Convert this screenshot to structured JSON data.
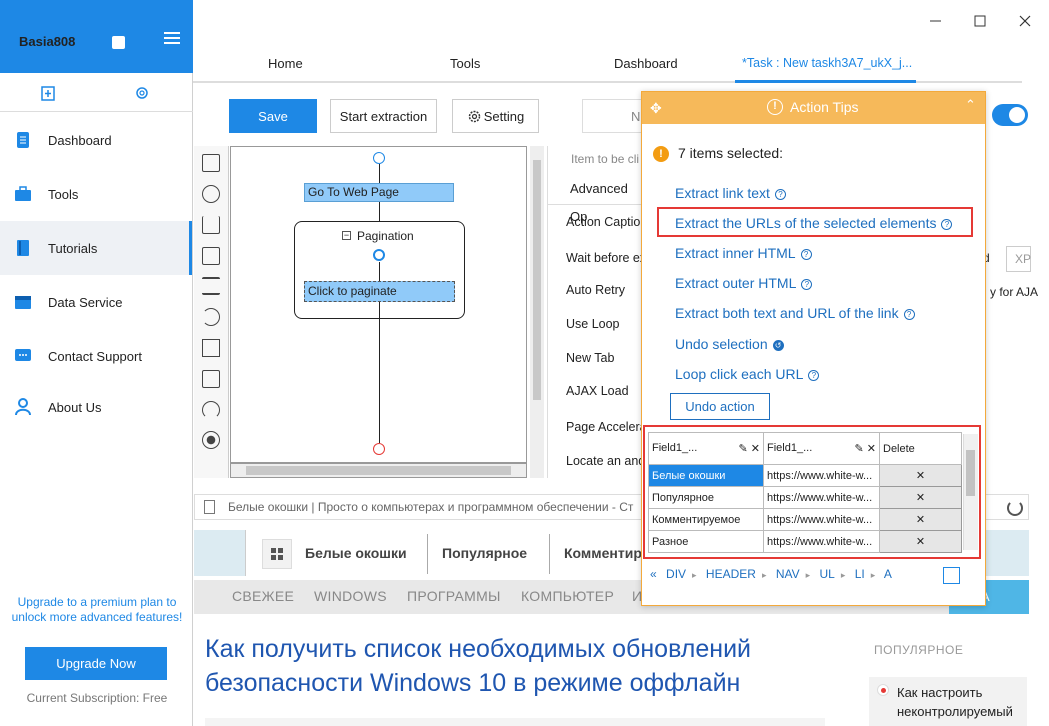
{
  "sidebar": {
    "username": "Basia808",
    "items": [
      {
        "label": "Dashboard",
        "icon": "dashboard-icon"
      },
      {
        "label": "Tools",
        "icon": "tools-icon"
      },
      {
        "label": "Tutorials",
        "icon": "book-icon"
      },
      {
        "label": "Data Service",
        "icon": "data-service-icon"
      },
      {
        "label": "Contact Support",
        "icon": "chat-icon"
      },
      {
        "label": "About Us",
        "icon": "person-icon"
      }
    ],
    "active_item": "Tutorials",
    "upgrade_text": "Upgrade to a premium plan to unlock more advanced features!",
    "upgrade_button": "Upgrade Now",
    "subscription": "Current Subscription: Free"
  },
  "tabs": [
    {
      "label": "Home"
    },
    {
      "label": "Tools"
    },
    {
      "label": "Dashboard"
    },
    {
      "label": "*Task : New taskh3A7_ukX_j..."
    }
  ],
  "toolbar": {
    "save": "Save",
    "start": "Start extraction",
    "setting": "Setting",
    "next_partial": "N"
  },
  "workflow": {
    "go_to_web_page": "Go To Web Page",
    "pagination": "Pagination",
    "click_to_paginate": "Click to paginate"
  },
  "options": {
    "hint": "Item to be cli",
    "tab": "Advanced Op",
    "rows": [
      "Action Caption",
      "Wait before ex",
      "Auto Retry",
      "Use Loop",
      "New Tab",
      "AJAX Load",
      "Page Accelera",
      "Locate an and"
    ],
    "d_label": "d",
    "xp_box": "XP",
    "ajax_label": "y for AJA"
  },
  "browser": {
    "address": "Белые окошки | Просто о компьютерах и программном обеспечении - Ст",
    "nav": [
      "Белые окошки",
      "Популярное",
      "Комментир"
    ],
    "menu": [
      "СВЕЖЕЕ",
      "WINDOWS",
      "ПРОГРАММЫ",
      "КОМПЬЮТЕР",
      "И"
    ],
    "menu_last": "А",
    "headline": "Как получить список необходимых обновлений безопасности Windows 10 в режиме оффлайн",
    "side_title": "ПОПУЛЯРНОЕ",
    "side_item": "Как настроить неконтролируемый"
  },
  "tips": {
    "title": "Action Tips",
    "selected": "7 items selected:",
    "actions": [
      "Extract link text",
      "Extract the URLs of the selected elements",
      "Extract inner HTML",
      "Extract outer HTML",
      "Extract both text and URL of the link",
      "Undo selection",
      "Loop click each URL"
    ],
    "undo_action": "Undo action",
    "table": {
      "headers": [
        "Field1_...",
        "Field1_...",
        "Delete"
      ],
      "rows": [
        [
          "Белые окошки",
          "https://www.white-w..."
        ],
        [
          "Популярное",
          "https://www.white-w..."
        ],
        [
          "Комментируемое",
          "https://www.white-w..."
        ],
        [
          "Разное",
          "https://www.white-w..."
        ]
      ]
    },
    "breadcrumbs": [
      "«",
      "DIV",
      "HEADER",
      "NAV",
      "UL",
      "LI",
      "A"
    ]
  }
}
